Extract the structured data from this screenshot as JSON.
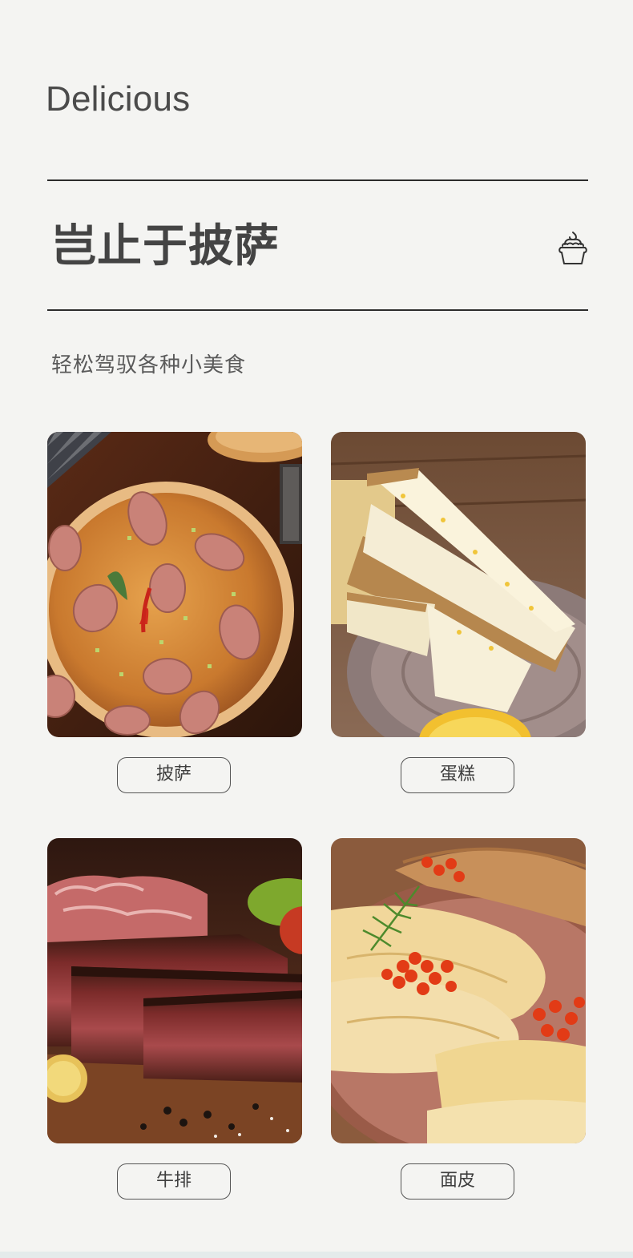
{
  "header": {
    "eyebrow": "Delicious",
    "title": "岂止于披萨",
    "subtitle": "轻松驾驭各种小美食",
    "icon": "cupcake-icon"
  },
  "foods": [
    {
      "label": "披萨",
      "image": "pizza-photo"
    },
    {
      "label": "蛋糕",
      "image": "cheesecake-photo"
    },
    {
      "label": "牛排",
      "image": "steak-photo"
    },
    {
      "label": "面皮",
      "image": "crepes-photo"
    }
  ],
  "colors": {
    "background": "#f4f4f2",
    "text": "#444444",
    "rule": "#2c2c2c"
  }
}
